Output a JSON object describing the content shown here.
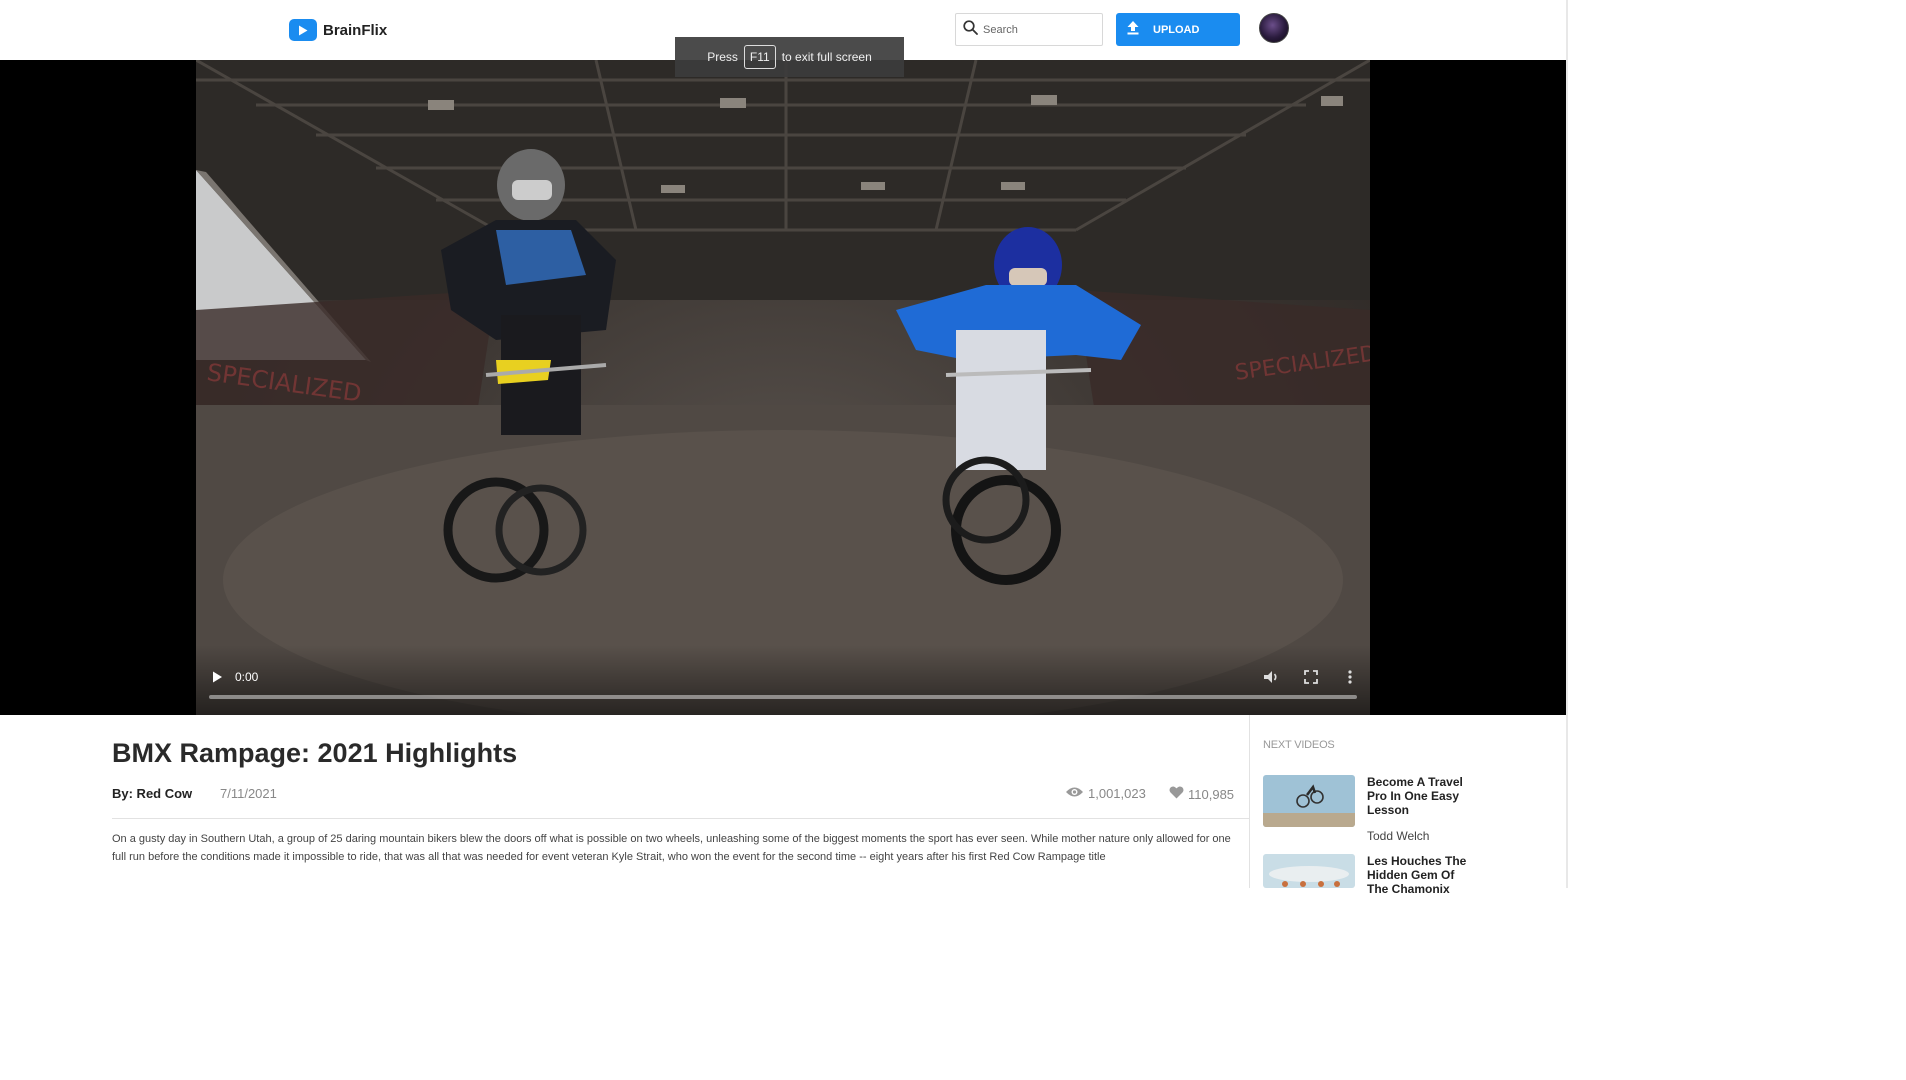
{
  "header": {
    "brand": "BrainFlix",
    "search_placeholder": "Search",
    "upload_label": "UPLOAD",
    "colors": {
      "accent": "#1a8cf0"
    }
  },
  "fullscreen_toast": {
    "prefix": "Press",
    "key": "F11",
    "suffix": "to exit full screen"
  },
  "player": {
    "time": "0:00",
    "icons": [
      "play-icon",
      "volume-icon",
      "fullscreen-icon",
      "more-options-icon"
    ]
  },
  "video": {
    "title": "BMX Rampage: 2021 Highlights",
    "author": "By: Red Cow",
    "date": "7/11/2021",
    "views": "1,001,023",
    "likes": "110,985",
    "description": "On a gusty day in Southern Utah, a group of 25 daring mountain bikers blew the doors off what is possible on two wheels, unleashing some of the biggest moments the sport has ever seen. While mother nature only allowed for one full run before the conditions made it impossible to ride, that was all that was needed for event veteran Kyle Strait, who won the event for the second time -- eight years after his first Red Cow Rampage title"
  },
  "sidebar": {
    "heading": "NEXT VIDEOS",
    "items": [
      {
        "title": "Become A Travel Pro In One Easy Lesson",
        "author": "Todd Welch"
      },
      {
        "title": "Les Houches The Hidden Gem Of The Chamonix",
        "author": ""
      }
    ]
  }
}
